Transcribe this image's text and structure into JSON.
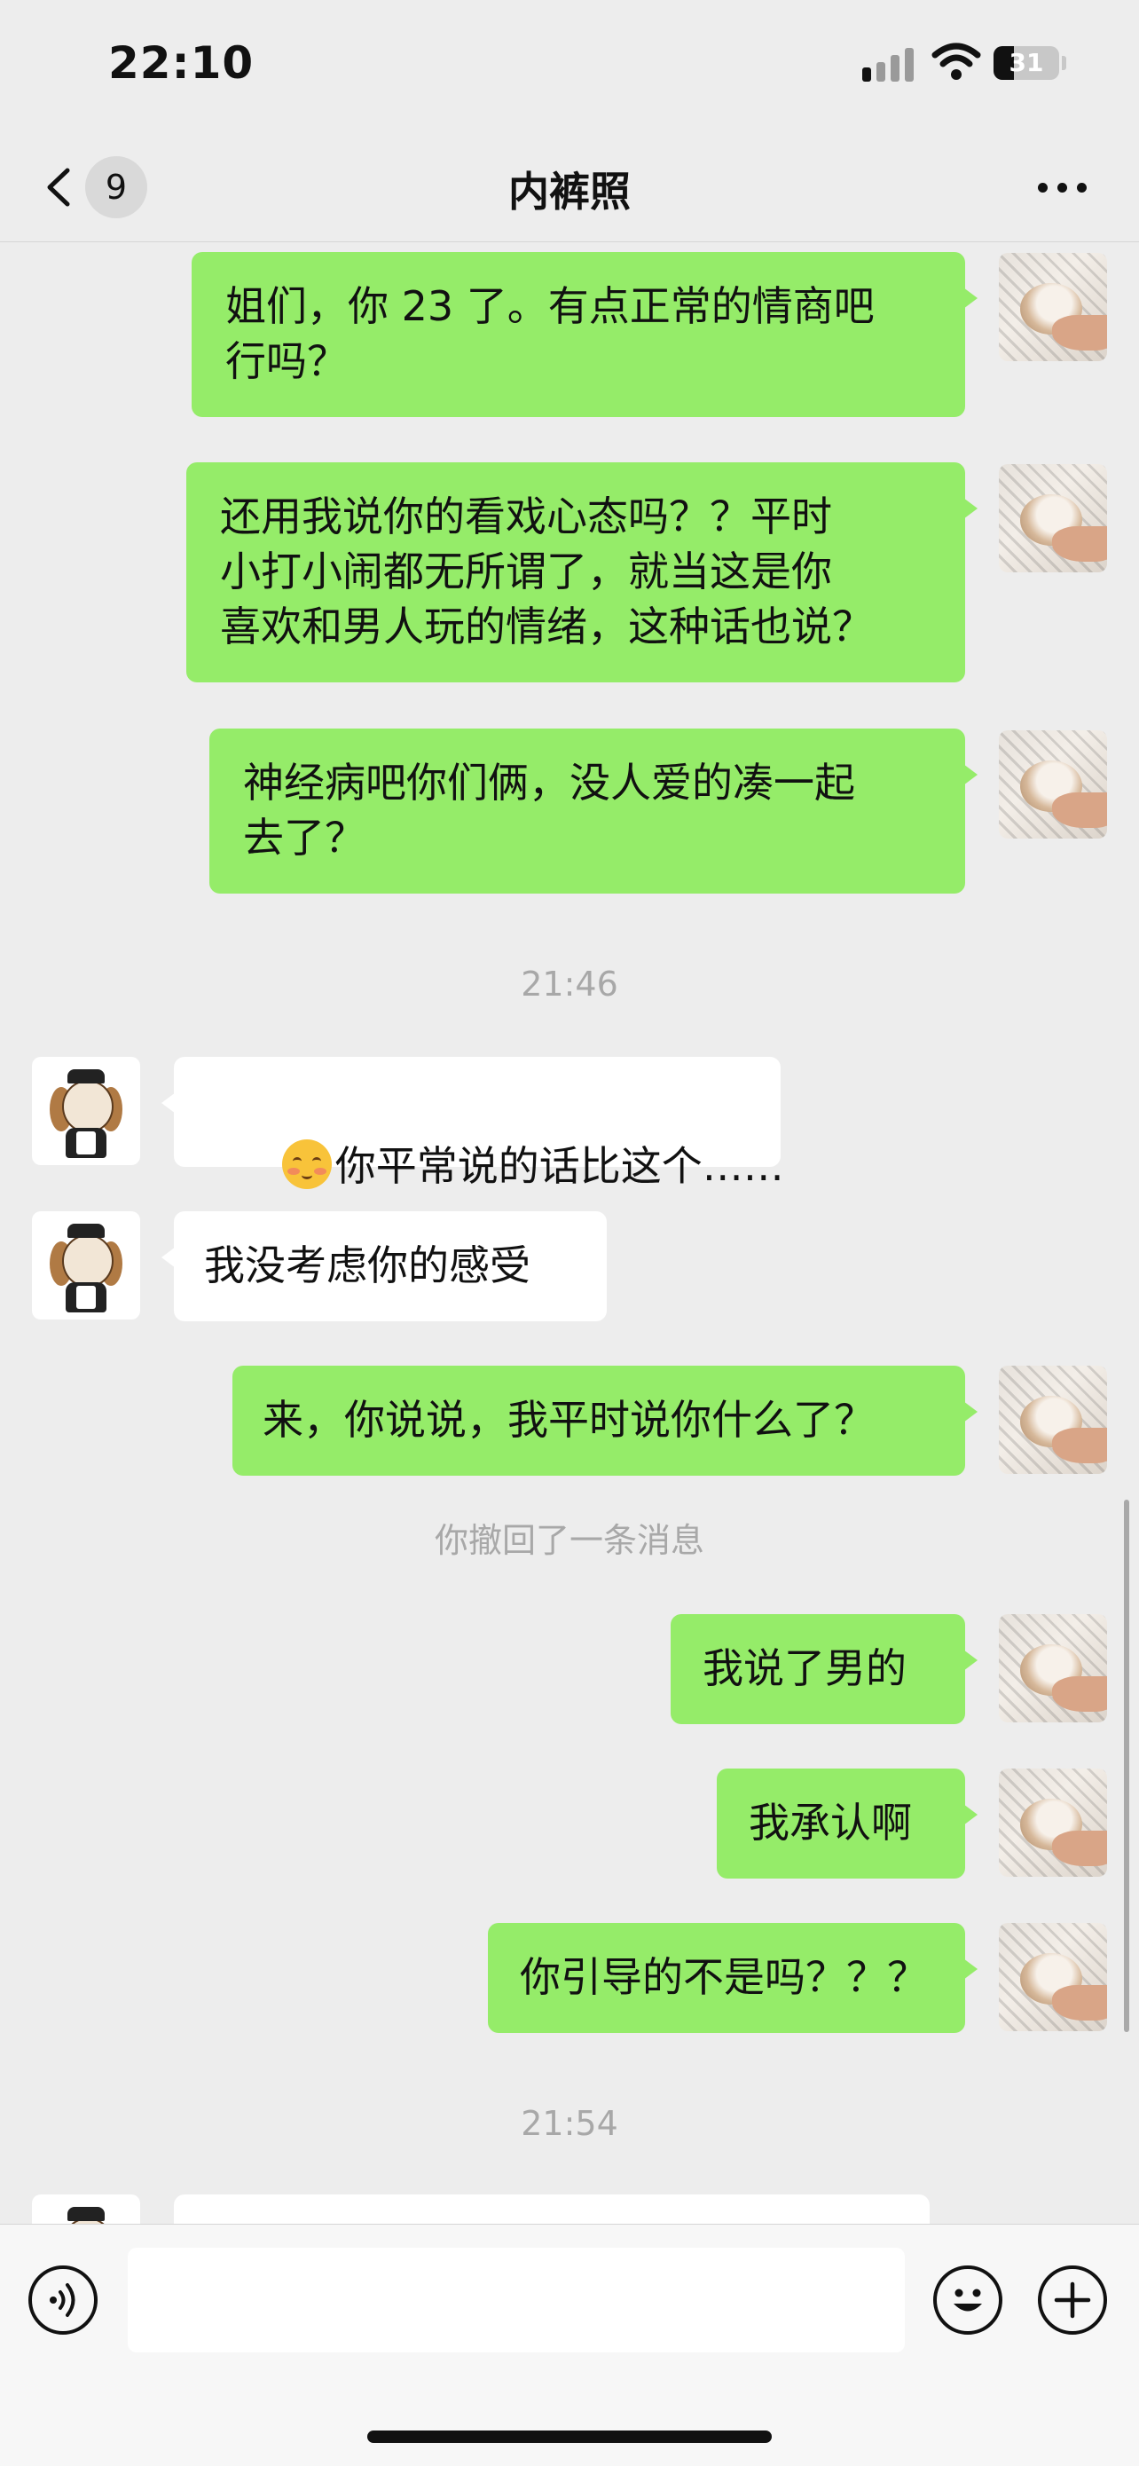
{
  "status_bar": {
    "time": "22:10",
    "battery": "31",
    "battery_level": 0.31
  },
  "nav": {
    "unread_count": "9",
    "title": "内裤照",
    "icons": {
      "back": "chevron-left-icon",
      "more": "more-dots-icon"
    }
  },
  "messages": [
    {
      "side": "out",
      "lines": [
        "姐们，你 23 了。有点正常的情商吧",
        "行吗？"
      ]
    },
    {
      "side": "out",
      "lines": [
        "还用我说你的看戏心态吗？？平时",
        "小打小闹都无所谓了，就当这是你",
        "喜欢和男人玩的情绪，这种话也说？"
      ]
    },
    {
      "side": "out",
      "lines": [
        "神经病吧你们俩，没人爱的凑一起",
        "去了？"
      ]
    },
    {
      "type": "timestamp",
      "text": "21:46"
    },
    {
      "side": "in",
      "emoji": "pouting-face-icon",
      "text": "你平常说的话比这个……"
    },
    {
      "side": "in",
      "text": "我没考虑你的感受"
    },
    {
      "side": "out",
      "text": "来，你说说，我平时说你什么了？"
    },
    {
      "type": "system",
      "text": "你撤回了一条消息"
    },
    {
      "side": "out",
      "text": "我说了男的"
    },
    {
      "side": "out",
      "text": "我承认啊"
    },
    {
      "side": "out",
      "text": "你引导的不是吗？？？"
    },
    {
      "type": "timestamp",
      "text": "21:54"
    }
  ],
  "input_bar": {
    "placeholder": "",
    "icons": {
      "voice": "voice-icon",
      "emoji": "emoji-icon",
      "add": "add-icon"
    }
  },
  "colors": {
    "background": "#ededed",
    "outgoing_bubble": "#95ec69",
    "incoming_bubble": "#ffffff"
  }
}
